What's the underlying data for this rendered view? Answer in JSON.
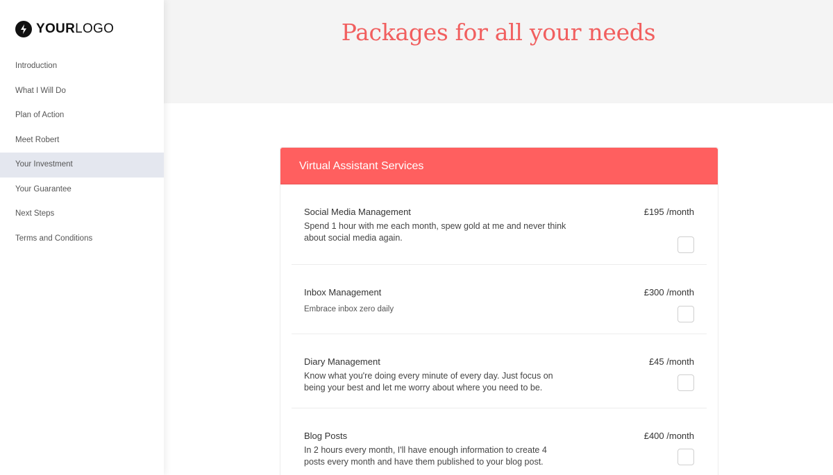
{
  "logo": {
    "bold": "YOUR",
    "light": "LOGO",
    "icon": "lightning-bolt-icon"
  },
  "sidebar": {
    "items": [
      {
        "label": "Introduction",
        "active": false
      },
      {
        "label": "What I Will Do",
        "active": false
      },
      {
        "label": "Plan of Action",
        "active": false
      },
      {
        "label": "Meet Robert",
        "active": false
      },
      {
        "label": "Your Investment",
        "active": true
      },
      {
        "label": "Your Guarantee",
        "active": false
      },
      {
        "label": "Next Steps",
        "active": false
      },
      {
        "label": "Terms and Conditions",
        "active": false
      }
    ]
  },
  "hero": {
    "title": "Packages for all your needs"
  },
  "card": {
    "title": "Virtual Assistant Services",
    "items": [
      {
        "name": "Social Media Management",
        "description": "Spend 1 hour with me each month, spew gold at me and never think about social media again.",
        "price": "£195 /month",
        "checked": false
      },
      {
        "name": "Inbox Management",
        "description": "Embrace inbox zero daily",
        "price": "£300 /month",
        "checked": false
      },
      {
        "name": "Diary Management",
        "description": "Know what you're doing every minute of every day. Just focus on being your best and let me worry about where you need to be.",
        "price": "£45 /month",
        "checked": false
      },
      {
        "name": "Blog Posts",
        "description": "In 2 hours every month, I'll have enough information to create 4 posts every month and have them published to your blog post.",
        "price": "£400 /month",
        "checked": false
      }
    ]
  },
  "colors": {
    "accent": "#f15f5f",
    "card_header": "#ff5f5f",
    "active_nav": "#e4e7ef",
    "hero_bg": "#f4f4f4"
  }
}
